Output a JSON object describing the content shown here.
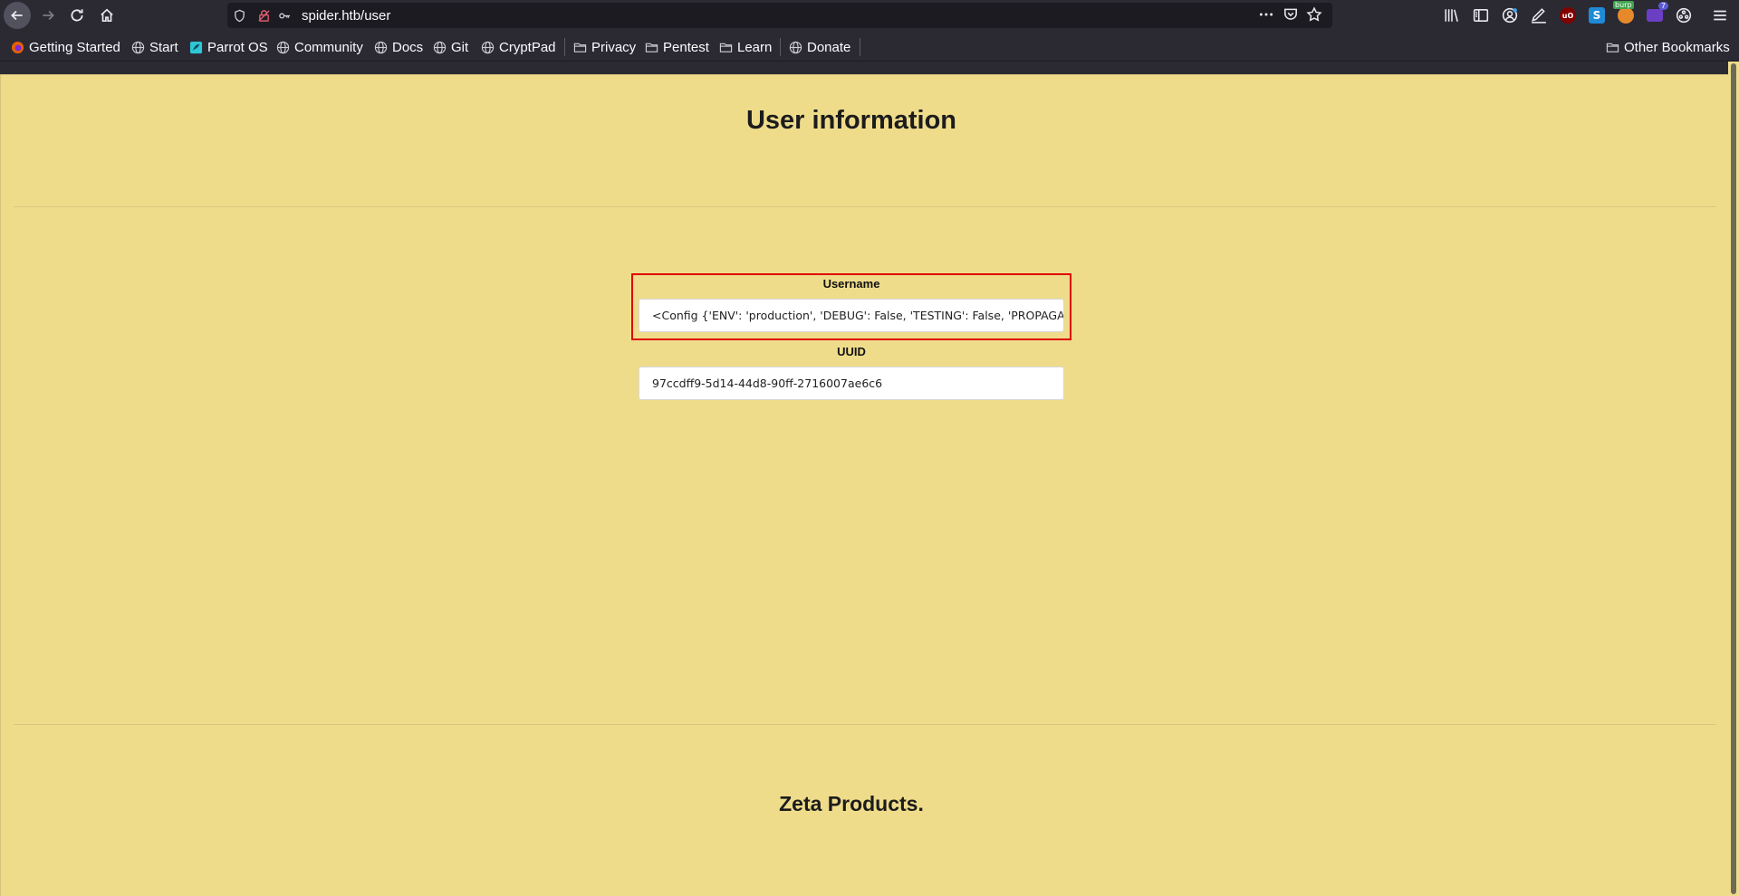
{
  "browser": {
    "url": "spider.htb/user",
    "bookmarks": [
      {
        "label": "Getting Started",
        "icon": "firefox-icon"
      },
      {
        "label": "Start",
        "icon": "globe-icon"
      },
      {
        "label": "Parrot OS",
        "icon": "parrot-icon"
      },
      {
        "label": "Community",
        "icon": "globe-icon"
      },
      {
        "label": "Docs",
        "icon": "globe-icon"
      },
      {
        "label": "Git",
        "icon": "globe-icon"
      },
      {
        "label": "CryptPad",
        "icon": "globe-icon"
      },
      {
        "label": "Privacy",
        "icon": "folder-icon"
      },
      {
        "label": "Pentest",
        "icon": "folder-icon"
      },
      {
        "label": "Learn",
        "icon": "folder-icon"
      },
      {
        "label": "Donate",
        "icon": "globe-icon"
      }
    ],
    "other_bookmarks": "Other Bookmarks",
    "extensions": {
      "burp_badge": "burp",
      "purple_badge": "7",
      "ublock_label": "uO",
      "s_label": "S"
    }
  },
  "page": {
    "title": "User information",
    "username_label": "Username",
    "username_value": "<Config {'ENV': 'production', 'DEBUG': False, 'TESTING': False, 'PROPAGATE_EXCEPTIONS': None, 'PRESERVE_CONTEXT_ON_EXCEPTION': None",
    "uuid_label": "UUID",
    "uuid_value": "97ccdff9-5d14-44d8-90ff-2716007ae6c6",
    "footer_title": "Zeta Products.",
    "background_color": "#efdc8b",
    "highlight_color": "#e00000"
  }
}
